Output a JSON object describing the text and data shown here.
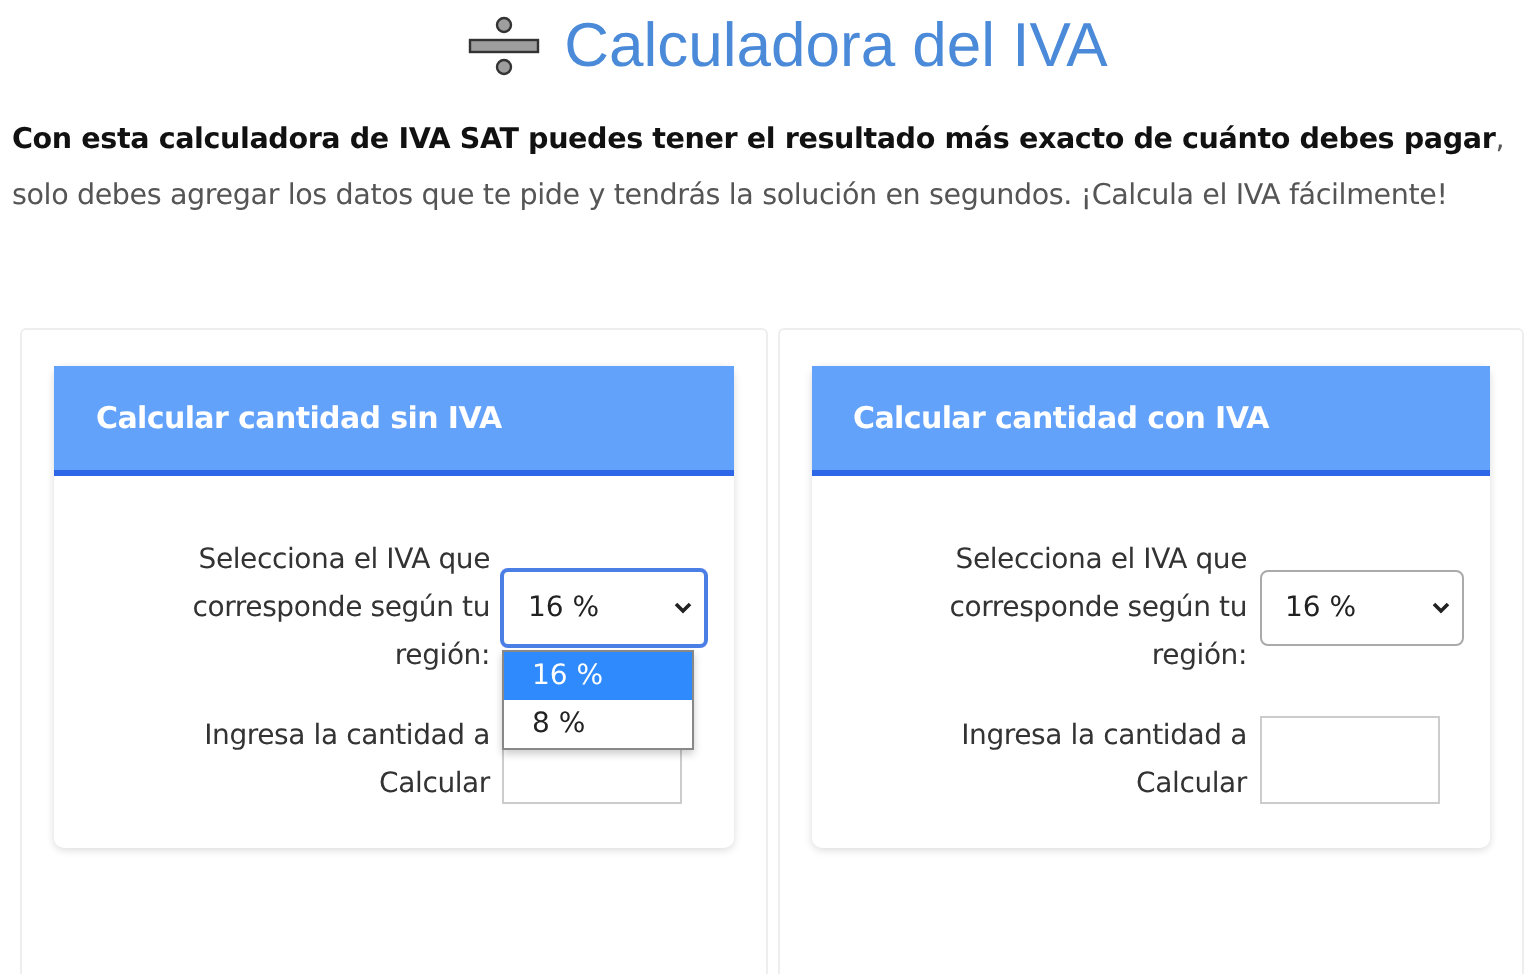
{
  "title": "Calculadora del IVA",
  "intro": "**Con esta calculadora de IVA SAT puedes tener el resultado más exacto de cuánto debes pagar**, solo debes agregar los datos que te pide y tendrás la solución en segundos. ¡Calcula el IVA fácilmente!",
  "panels": [
    {
      "title": "Calcular cantidad sin IVA",
      "select_label": "Selecciona el IVA que corresponde según tu región:",
      "select": {
        "value": "16 %",
        "focused": true,
        "open": true,
        "options": [
          {
            "label": "16 %",
            "selected": true
          },
          {
            "label": "8 %",
            "selected": false
          }
        ]
      },
      "amount_label": "Ingresa la cantidad a Calcular"
    },
    {
      "title": "Calcular cantidad con IVA",
      "select_label": "Selecciona el IVA que corresponde según tu región:",
      "select": {
        "value": "16 %",
        "focused": false
      },
      "amount_label": "Ingresa la cantidad a Calcular"
    }
  ]
}
